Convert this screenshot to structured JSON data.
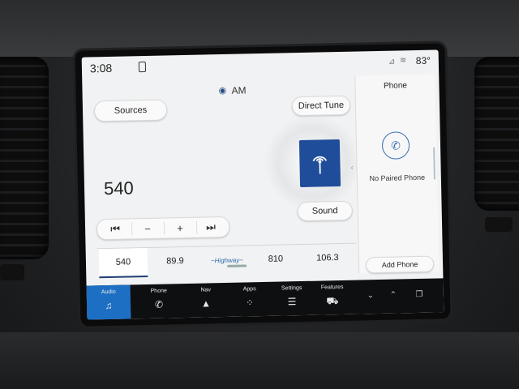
{
  "status": {
    "time": "3:08",
    "temperature": "83°"
  },
  "source": {
    "label": "AM"
  },
  "buttons": {
    "sources": "Sources",
    "direct_tune": "Direct Tune",
    "sound": "Sound"
  },
  "tuner": {
    "frequency": "540"
  },
  "controls": {
    "seek_back": "⏮",
    "minus": "−",
    "plus": "+",
    "seek_forward": "⏭"
  },
  "presets": [
    {
      "label": "540",
      "active": true
    },
    {
      "label": "89.9"
    },
    {
      "label": "logo"
    },
    {
      "label": "810"
    },
    {
      "label": "106.3"
    }
  ],
  "phone_panel": {
    "title": "Phone",
    "status": "No Paired Phone",
    "add_button": "Add Phone"
  },
  "nav": [
    {
      "label": "Audio",
      "icon": "music-note-icon",
      "glyph": "♫",
      "active": true
    },
    {
      "label": "Phone",
      "icon": "phone-icon",
      "glyph": "✆"
    },
    {
      "label": "Nav",
      "icon": "navigation-icon",
      "glyph": "▲"
    },
    {
      "label": "Apps",
      "icon": "apps-grid-icon",
      "glyph": "⁘"
    },
    {
      "label": "Settings",
      "icon": "sliders-icon",
      "glyph": "☰"
    },
    {
      "label": "Features",
      "icon": "car-icon",
      "glyph": "⛟"
    }
  ],
  "colors": {
    "active_tab": "#1d6fc4",
    "radio_tile": "#1f4d9a"
  }
}
